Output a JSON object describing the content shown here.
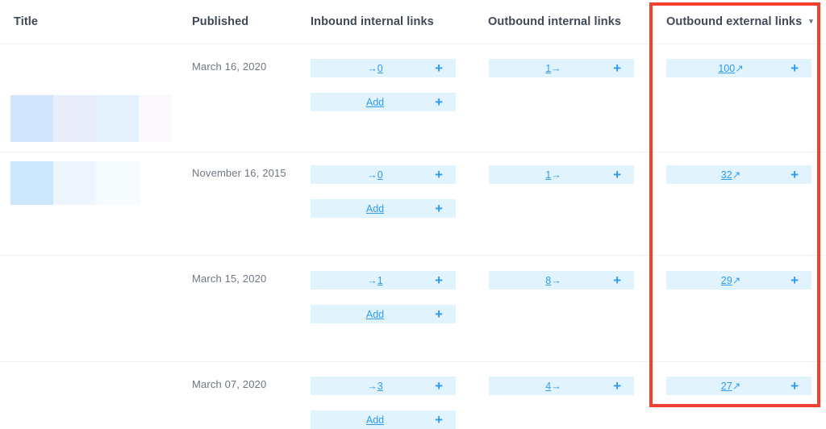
{
  "table": {
    "columns": [
      {
        "key": "title",
        "label": "Title"
      },
      {
        "key": "published",
        "label": "Published"
      },
      {
        "key": "inbound",
        "label": "Inbound internal links"
      },
      {
        "key": "outbound_int",
        "label": "Outbound internal links"
      },
      {
        "key": "outbound_ext",
        "label": "Outbound external links",
        "sort_caret": "▾"
      }
    ],
    "rows": [
      {
        "published": "March 16, 2020",
        "inbound": {
          "arrow": "→",
          "value": "0"
        },
        "inbound_add": {
          "label": "Add"
        },
        "outbound_int": {
          "value": "1",
          "arrow": "→"
        },
        "outbound_ext": {
          "value": "100",
          "arrow": "↗"
        }
      },
      {
        "published": "November 16, 2015",
        "inbound": {
          "arrow": "→",
          "value": "0"
        },
        "inbound_add": {
          "label": "Add"
        },
        "outbound_int": {
          "value": "1",
          "arrow": "→"
        },
        "outbound_ext": {
          "value": "32",
          "arrow": "↗"
        }
      },
      {
        "published": "March 15, 2020",
        "inbound": {
          "arrow": "→",
          "value": "1"
        },
        "inbound_add": {
          "label": "Add"
        },
        "outbound_int": {
          "value": "8",
          "arrow": "→"
        },
        "outbound_ext": {
          "value": "29",
          "arrow": "↗"
        }
      },
      {
        "published": "March 07, 2020",
        "inbound": {
          "arrow": "→",
          "value": "3"
        },
        "inbound_add": {
          "label": "Add"
        },
        "outbound_int": {
          "value": "4",
          "arrow": "→"
        },
        "outbound_ext": {
          "value": "27",
          "arrow": "↗"
        }
      }
    ],
    "add_plus_icon": "+"
  },
  "colors": {
    "pill_bg": "#e1f3fd",
    "link": "#2e9bf0",
    "header_text": "#3f4a58",
    "date_text": "#6e7682",
    "row_divider": "#eef0f3",
    "highlight_box": "#f4402e"
  }
}
